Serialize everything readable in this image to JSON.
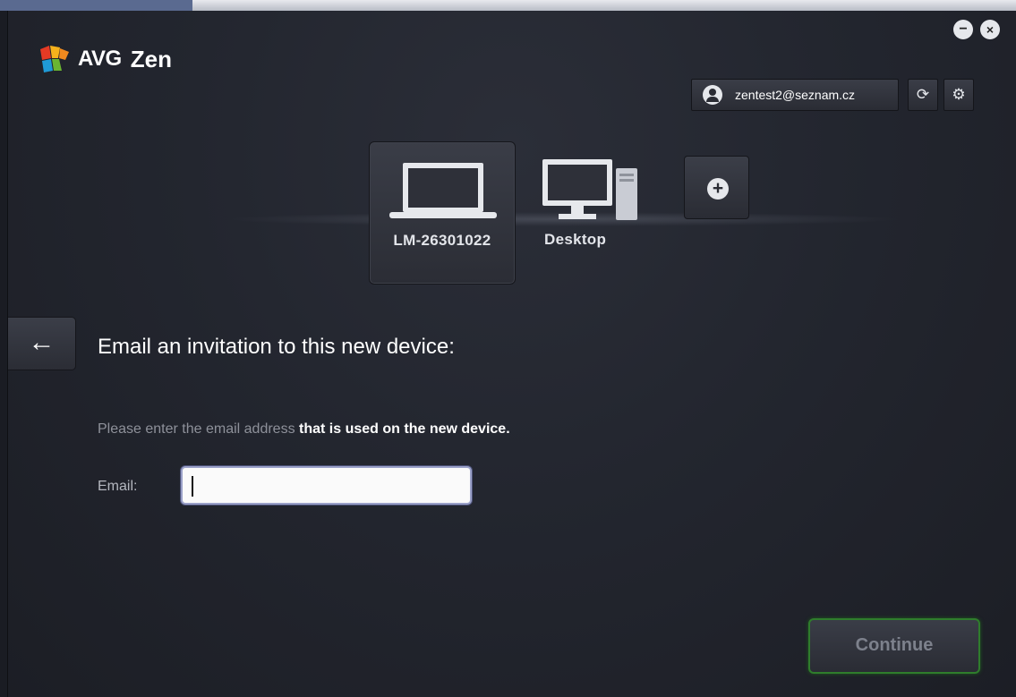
{
  "window": {
    "minimize_glyph": "−",
    "close_glyph": "×"
  },
  "brand": {
    "company": "AVG",
    "product": "Zen",
    "logo_colors": [
      "#e53a24",
      "#f6b21c",
      "#1f9ad6",
      "#6bb531"
    ]
  },
  "header": {
    "account_email": "zentest2@seznam.cz",
    "user_icon": "user-icon",
    "refresh_icon": "refresh-icon",
    "refresh_glyph": "⟳",
    "settings_icon": "gear-icon",
    "settings_glyph": "⚙"
  },
  "devices": [
    {
      "name": "LM-26301022",
      "type": "laptop",
      "selected": true
    },
    {
      "name": "Desktop",
      "type": "desktop",
      "selected": false
    }
  ],
  "add_device": {
    "glyph": "+"
  },
  "nav": {
    "back_glyph": "←"
  },
  "invite": {
    "heading": "Email an invitation to this new device:",
    "hint_dim": "Please enter the email address",
    "hint_bold": "that is used on the new device.",
    "email_label": "Email:",
    "email_value": "",
    "continue_label": "Continue"
  },
  "colors": {
    "accent_green": "#2f7d2c",
    "background": "#23262f",
    "input_border": "#9aa0c8"
  }
}
